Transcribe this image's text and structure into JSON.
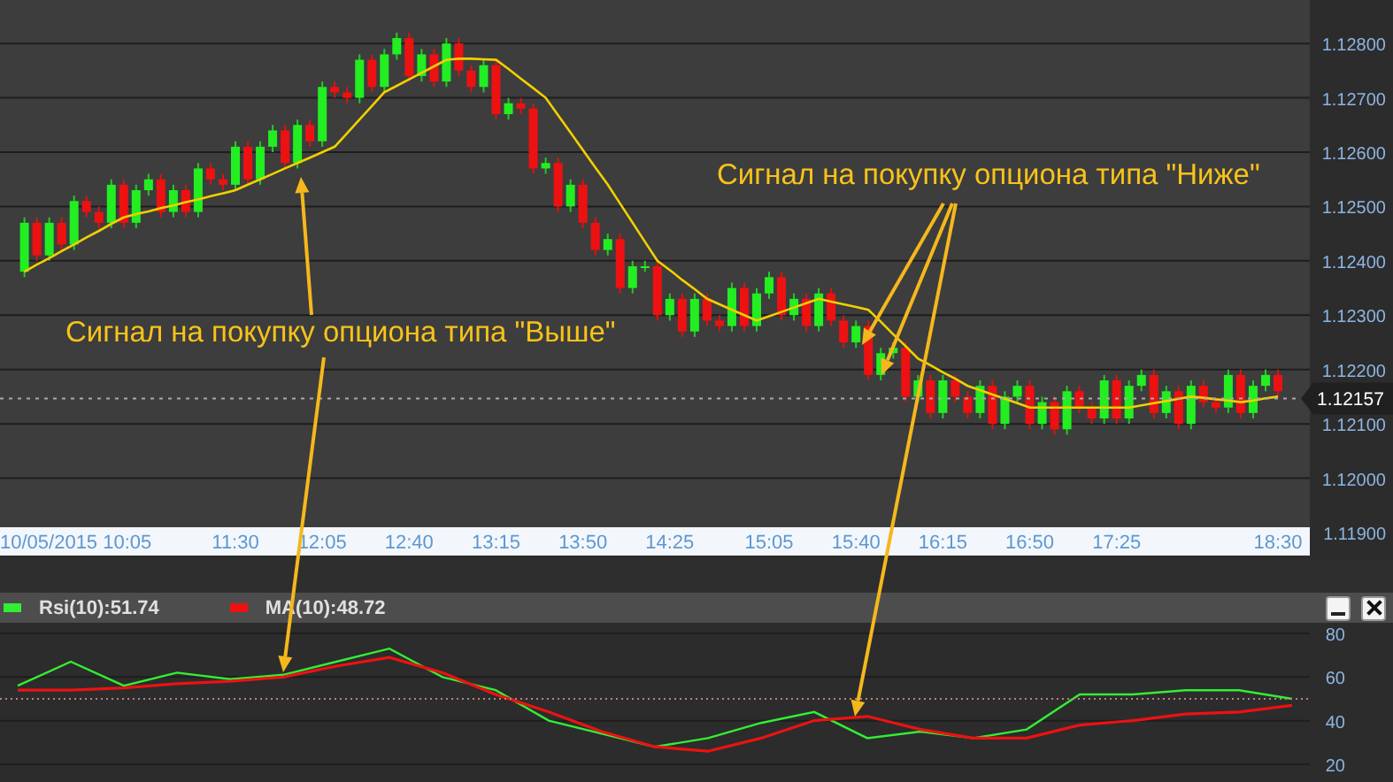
{
  "price_chart": {
    "chart_data": {
      "type": "candlestick",
      "categories": [
        null,
        null,
        null,
        null,
        null,
        null,
        null,
        null,
        null,
        null,
        null,
        null,
        null,
        null,
        null,
        null,
        null,
        "11:30",
        null,
        null,
        null,
        null,
        null,
        null,
        "12:05",
        null,
        null,
        null,
        null,
        null,
        null,
        "12:40",
        null,
        null,
        null,
        null,
        null,
        null,
        "13:15",
        null,
        null,
        null,
        null,
        null,
        null,
        "13:50",
        null,
        null,
        null,
        null,
        null,
        null,
        "14:25",
        null,
        null,
        null,
        null,
        null,
        null,
        null,
        "15:05",
        null,
        null,
        null,
        null,
        null,
        null,
        "15:40",
        null,
        null,
        null,
        null,
        null,
        null,
        "16:15",
        null,
        null,
        null,
        null,
        null,
        null,
        "16:50",
        null,
        null,
        null,
        null,
        null,
        null,
        "17:25",
        null,
        null,
        null,
        null,
        null,
        null,
        null,
        null,
        null,
        null,
        null,
        null,
        "18:30"
      ],
      "ohlc": [
        [
          1.1238,
          1.1248,
          1.1237,
          1.1247
        ],
        [
          1.1247,
          1.1248,
          1.124,
          1.1241
        ],
        [
          1.1241,
          1.1248,
          1.124,
          1.1247
        ],
        [
          1.1247,
          1.1248,
          1.1242,
          1.1243
        ],
        [
          1.1243,
          1.1252,
          1.1242,
          1.1251
        ],
        [
          1.1251,
          1.1252,
          1.1248,
          1.1249
        ],
        [
          1.1249,
          1.125,
          1.1246,
          1.1247
        ],
        [
          1.1247,
          1.1255,
          1.1246,
          1.1254
        ],
        [
          1.1254,
          1.1255,
          1.1246,
          1.1247
        ],
        [
          1.1247,
          1.1254,
          1.1246,
          1.1253
        ],
        [
          1.1253,
          1.1256,
          1.1252,
          1.1255
        ],
        [
          1.1255,
          1.1256,
          1.1248,
          1.1249
        ],
        [
          1.1249,
          1.1254,
          1.1248,
          1.1253
        ],
        [
          1.1253,
          1.1254,
          1.1248,
          1.1249
        ],
        [
          1.1249,
          1.1258,
          1.1248,
          1.1257
        ],
        [
          1.1257,
          1.1258,
          1.1254,
          1.1255
        ],
        [
          1.1255,
          1.1256,
          1.1253,
          1.1254
        ],
        [
          1.1254,
          1.1262,
          1.1253,
          1.1261
        ],
        [
          1.1261,
          1.1262,
          1.1254,
          1.1255
        ],
        [
          1.1255,
          1.1262,
          1.1254,
          1.1261
        ],
        [
          1.1261,
          1.1265,
          1.126,
          1.1264
        ],
        [
          1.1264,
          1.1265,
          1.1257,
          1.1258
        ],
        [
          1.1258,
          1.1266,
          1.1257,
          1.1265
        ],
        [
          1.1265,
          1.1266,
          1.1261,
          1.1262
        ],
        [
          1.1262,
          1.1273,
          1.1261,
          1.1272
        ],
        [
          1.1272,
          1.1273,
          1.127,
          1.1271
        ],
        [
          1.1271,
          1.1272,
          1.1269,
          1.127
        ],
        [
          1.127,
          1.1278,
          1.1269,
          1.1277
        ],
        [
          1.1277,
          1.1278,
          1.1271,
          1.1272
        ],
        [
          1.1272,
          1.1279,
          1.1271,
          1.1278
        ],
        [
          1.1278,
          1.1282,
          1.1277,
          1.1281
        ],
        [
          1.1281,
          1.1282,
          1.1273,
          1.1274
        ],
        [
          1.1274,
          1.1279,
          1.1273,
          1.1278
        ],
        [
          1.1278,
          1.1279,
          1.1272,
          1.1273
        ],
        [
          1.1273,
          1.1281,
          1.1272,
          1.128
        ],
        [
          1.128,
          1.1281,
          1.1274,
          1.1275
        ],
        [
          1.1275,
          1.1276,
          1.1271,
          1.1272
        ],
        [
          1.1272,
          1.1277,
          1.1271,
          1.1276
        ],
        [
          1.1276,
          1.1277,
          1.1266,
          1.1267
        ],
        [
          1.1267,
          1.127,
          1.1266,
          1.1269
        ],
        [
          1.1269,
          1.127,
          1.1267,
          1.1268
        ],
        [
          1.1268,
          1.1269,
          1.1256,
          1.1257
        ],
        [
          1.1257,
          1.1259,
          1.1256,
          1.1258
        ],
        [
          1.1258,
          1.1259,
          1.1249,
          1.125
        ],
        [
          1.125,
          1.1255,
          1.1249,
          1.1254
        ],
        [
          1.1254,
          1.1255,
          1.1246,
          1.1247
        ],
        [
          1.1247,
          1.1248,
          1.1241,
          1.1242
        ],
        [
          1.1242,
          1.1245,
          1.1241,
          1.1244
        ],
        [
          1.1244,
          1.1245,
          1.1234,
          1.1235
        ],
        [
          1.1235,
          1.124,
          1.1234,
          1.1239
        ],
        [
          1.1239,
          1.124,
          1.1238,
          1.1239
        ],
        [
          1.1239,
          1.124,
          1.1229,
          1.123
        ],
        [
          1.123,
          1.1234,
          1.1229,
          1.1233
        ],
        [
          1.1233,
          1.1234,
          1.1226,
          1.1227
        ],
        [
          1.1227,
          1.1234,
          1.1226,
          1.1233
        ],
        [
          1.1233,
          1.1234,
          1.1228,
          1.1229
        ],
        [
          1.1229,
          1.123,
          1.1227,
          1.1228
        ],
        [
          1.1228,
          1.1236,
          1.1227,
          1.1235
        ],
        [
          1.1235,
          1.1236,
          1.1227,
          1.1228
        ],
        [
          1.1228,
          1.1235,
          1.1227,
          1.1234
        ],
        [
          1.1234,
          1.1238,
          1.1233,
          1.1237
        ],
        [
          1.1237,
          1.1238,
          1.1229,
          1.123
        ],
        [
          1.123,
          1.1234,
          1.1229,
          1.1233
        ],
        [
          1.1233,
          1.1234,
          1.1227,
          1.1228
        ],
        [
          1.1228,
          1.1235,
          1.1227,
          1.1234
        ],
        [
          1.1234,
          1.1235,
          1.1228,
          1.1229
        ],
        [
          1.1229,
          1.123,
          1.1224,
          1.1225
        ],
        [
          1.1225,
          1.1229,
          1.1224,
          1.1228
        ],
        [
          1.1228,
          1.1229,
          1.1218,
          1.1219
        ],
        [
          1.1219,
          1.1224,
          1.1218,
          1.1223
        ],
        [
          1.1223,
          1.1225,
          1.1222,
          1.1224
        ],
        [
          1.1224,
          1.1225,
          1.1214,
          1.1215
        ],
        [
          1.1215,
          1.1219,
          1.1214,
          1.1218
        ],
        [
          1.1218,
          1.1219,
          1.1211,
          1.1212
        ],
        [
          1.1212,
          1.1219,
          1.1211,
          1.1218
        ],
        [
          1.1218,
          1.1219,
          1.1214,
          1.1215
        ],
        [
          1.1215,
          1.1216,
          1.1211,
          1.1212
        ],
        [
          1.1212,
          1.1218,
          1.1211,
          1.1217
        ],
        [
          1.1217,
          1.1218,
          1.1209,
          1.121
        ],
        [
          1.121,
          1.1216,
          1.1209,
          1.1215
        ],
        [
          1.1215,
          1.1218,
          1.1214,
          1.1217
        ],
        [
          1.1217,
          1.1218,
          1.1209,
          1.121
        ],
        [
          1.121,
          1.1215,
          1.1209,
          1.1214
        ],
        [
          1.1214,
          1.1215,
          1.1208,
          1.1209
        ],
        [
          1.1209,
          1.1217,
          1.1208,
          1.1216
        ],
        [
          1.1216,
          1.1217,
          1.1212,
          1.1213
        ],
        [
          1.1213,
          1.1214,
          1.121,
          1.1211
        ],
        [
          1.1211,
          1.1219,
          1.121,
          1.1218
        ],
        [
          1.1218,
          1.1219,
          1.121,
          1.1211
        ],
        [
          1.1211,
          1.1218,
          1.121,
          1.1217
        ],
        [
          1.1217,
          1.122,
          1.1216,
          1.1219
        ],
        [
          1.1219,
          1.122,
          1.1211,
          1.1212
        ],
        [
          1.1212,
          1.1217,
          1.1211,
          1.1216
        ],
        [
          1.1216,
          1.1217,
          1.1209,
          1.121
        ],
        [
          1.121,
          1.1218,
          1.1209,
          1.1217
        ],
        [
          1.1217,
          1.1218,
          1.1213,
          1.1214
        ],
        [
          1.1214,
          1.1215,
          1.1212,
          1.1213
        ],
        [
          1.1213,
          1.122,
          1.1212,
          1.1219
        ],
        [
          1.1219,
          1.122,
          1.1211,
          1.1212
        ],
        [
          1.1212,
          1.1218,
          1.1211,
          1.1217
        ],
        [
          1.1217,
          1.122,
          1.1216,
          1.1219
        ],
        [
          1.1219,
          1.122,
          1.1215,
          1.1216
        ]
      ],
      "series": [
        {
          "type": "line",
          "color": "#f0d000",
          "values": [
            1.1238,
            1.12393,
            1.12405,
            1.12418,
            1.1243,
            1.12443,
            1.12455,
            1.12468,
            1.1248,
            1.12486,
            1.12491,
            1.12497,
            1.12502,
            1.12508,
            1.12513,
            1.12519,
            1.12524,
            1.1253,
            1.1254,
            1.1255,
            1.1256,
            1.1257,
            1.1258,
            1.1259,
            1.126,
            1.1261,
            1.12635,
            1.1266,
            1.12685,
            1.1271,
            1.12722,
            1.12734,
            1.12746,
            1.12758,
            1.1277,
            1.12772,
            1.12772,
            1.12771,
            1.1277,
            1.12753,
            1.12735,
            1.12718,
            1.127,
            1.12668,
            1.12636,
            1.12604,
            1.12572,
            1.1254,
            1.12505,
            1.1247,
            1.12435,
            1.124,
            1.12383,
            1.12365,
            1.12348,
            1.1233,
            1.1232,
            1.1231,
            1.123,
            1.1229,
            1.12298,
            1.12306,
            1.12314,
            1.12322,
            1.1233,
            1.12325,
            1.1232,
            1.12315,
            1.1231,
            1.12288,
            1.12265,
            1.12243,
            1.1222,
            1.12208,
            1.12195,
            1.12183,
            1.1217,
            1.12162,
            1.12154,
            1.12146,
            1.12138,
            1.1213,
            1.1213,
            1.1213,
            1.1213,
            1.1213,
            1.1213,
            1.1213,
            1.1213,
            1.1213,
            1.12134,
            1.12138,
            1.12142,
            1.12146,
            1.1215,
            1.12148,
            1.12145,
            1.12143,
            1.1214,
            1.12143,
            1.12147,
            1.1215
          ]
        }
      ],
      "ylim": [
        1.119,
        1.1288
      ],
      "yticks": [
        {
          "value": 1.119,
          "label": "1.11900"
        },
        {
          "value": 1.12,
          "label": "1.12000"
        },
        {
          "value": 1.121,
          "label": "1.12100"
        },
        {
          "value": 1.122,
          "label": "1.12200"
        },
        {
          "value": 1.123,
          "label": "1.12300"
        },
        {
          "value": 1.124,
          "label": "1.12400"
        },
        {
          "value": 1.125,
          "label": "1.12500"
        },
        {
          "value": 1.126,
          "label": "1.12600"
        },
        {
          "value": 1.127,
          "label": "1.12700"
        },
        {
          "value": 1.128,
          "label": "1.12800"
        }
      ],
      "grid": true
    },
    "current_price": "1.12157",
    "start_label": "10/05/2015 10:05"
  },
  "annotations": [
    {
      "text": "Сигнал на покупку опциона типа \"Выше\""
    },
    {
      "text": "Сигнал на покупку опциона типа \"Ниже\""
    }
  ],
  "indicator_panel": {
    "chart_data": {
      "type": "line",
      "series": [
        {
          "name": "Rsi(10):51.74",
          "color": "#33ee33",
          "values": [
            56,
            67,
            56,
            62,
            59,
            61,
            67,
            73,
            60,
            54,
            40,
            34,
            28,
            32,
            39,
            44,
            32,
            35,
            32,
            36,
            52,
            52,
            54,
            54,
            50
          ]
        },
        {
          "name": "MA(10):48.72",
          "color": "#ee1111",
          "values": [
            54,
            54,
            55,
            57,
            58,
            60,
            65,
            69,
            62,
            52,
            44,
            35,
            28,
            26,
            32,
            40,
            42,
            36,
            32,
            32,
            38,
            40,
            43,
            44,
            47
          ]
        }
      ],
      "ylim": [
        20,
        80
      ],
      "yticks": [
        20,
        40,
        60,
        80
      ],
      "grid": true
    }
  }
}
